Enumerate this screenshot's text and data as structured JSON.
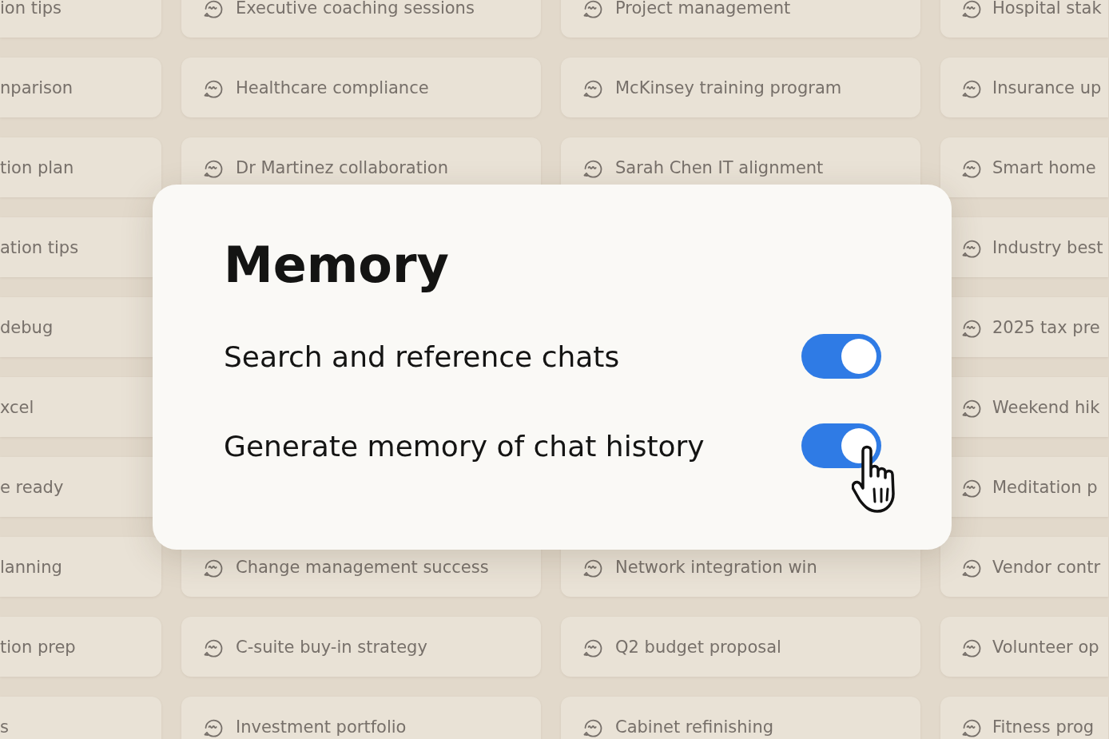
{
  "chat_rows": [
    {
      "chats": [
        "ion tips",
        "Executive coaching sessions",
        "Project management",
        "Hospital stak"
      ]
    },
    {
      "chats": [
        "nparison",
        "Healthcare compliance",
        "McKinsey training program",
        "Insurance up"
      ]
    },
    {
      "chats": [
        "tion plan",
        "Dr Martinez collaboration",
        "Sarah Chen IT alignment",
        "Smart home"
      ]
    },
    {
      "chats": [
        "ation tips",
        "Industry best"
      ]
    },
    {
      "chats": [
        "debug",
        "2025 tax pre"
      ]
    },
    {
      "chats": [
        "xcel",
        "Weekend hik"
      ]
    },
    {
      "chats": [
        "e ready",
        "Meditation p"
      ]
    },
    {
      "chats": [
        "lanning",
        "Change management success",
        "Network integration win",
        "Vendor contr"
      ]
    },
    {
      "chats": [
        "tion prep",
        "C-suite buy-in strategy",
        "Q2 budget proposal",
        "Volunteer op"
      ]
    },
    {
      "chats": [
        "s",
        "Investment portfolio",
        "Cabinet refinishing",
        "Fitness prog"
      ]
    }
  ],
  "dialog": {
    "title": "Memory",
    "settings": [
      {
        "label": "Search and reference chats",
        "on": true
      },
      {
        "label": "Generate memory of chat history",
        "on": true
      }
    ]
  }
}
